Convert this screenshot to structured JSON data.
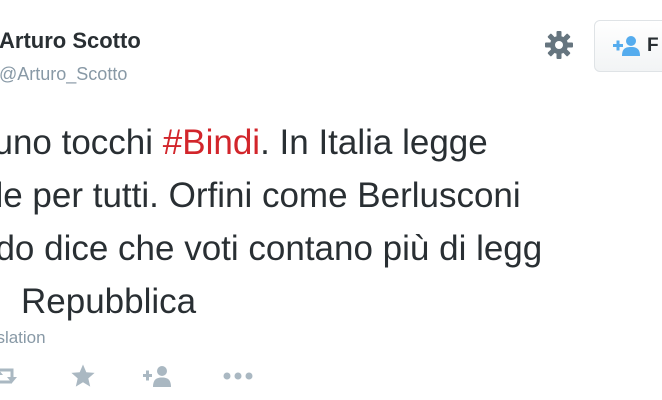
{
  "author": {
    "name": "Arturo Scotto",
    "handle": "@Arturo_Scotto"
  },
  "follow_button": {
    "label": "F",
    "icon": "add-user-icon"
  },
  "settings_icon": "gear-icon",
  "tweet": {
    "line1_before": "suno tocchi ",
    "hashtag": "#Bindi",
    "line1_after": ". In Italia legge",
    "line2": "ale per tutti. Orfini come Berlusconi",
    "line3": "ndo dice che voti contano più di legg",
    "line4": "Repubblica",
    "hashtag_color": "#d2252b"
  },
  "translation_link": "nslation",
  "actions": {
    "icons": [
      "retweet-icon",
      "favorite-icon",
      "follow-icon",
      "more-icon"
    ]
  }
}
